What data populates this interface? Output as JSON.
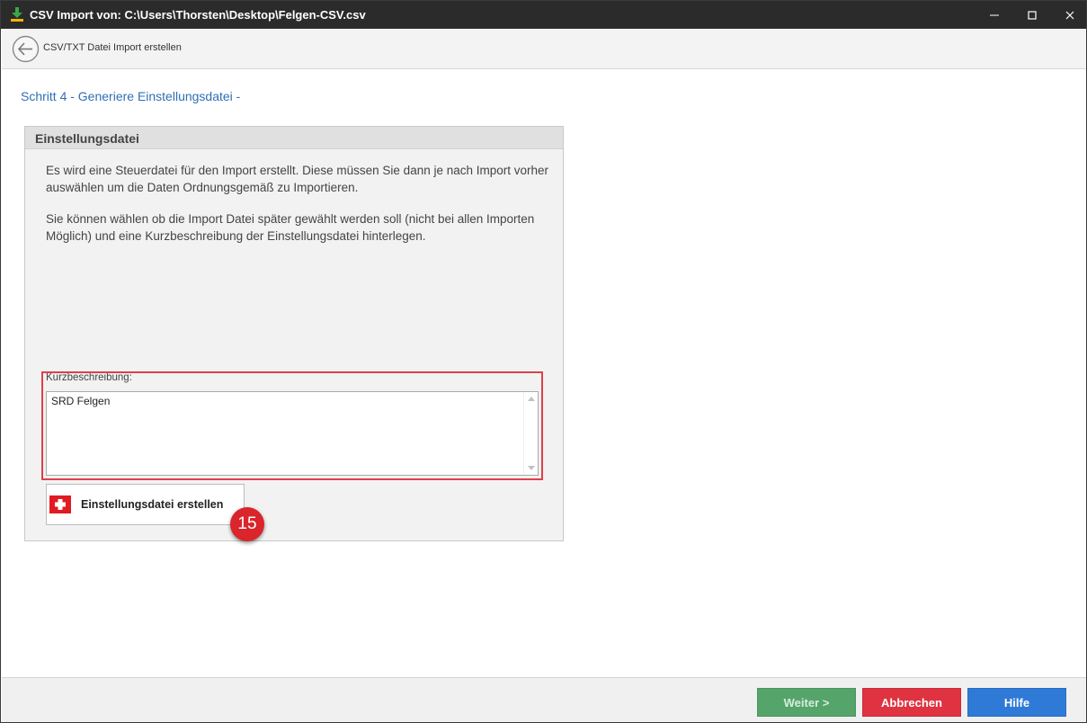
{
  "window": {
    "title": "CSV Import von: C:\\Users\\Thorsten\\Desktop\\Felgen-CSV.csv"
  },
  "navbar": {
    "title": "CSV/TXT Datei Import erstellen"
  },
  "step": {
    "title": "Schritt 4 - Generiere Einstellungsdatei -"
  },
  "panel": {
    "header": "Einstellungsdatei",
    "paragraph1": "Es wird eine Steuerdatei für den Import erstellt. Diese müssen Sie dann je nach Import vorher auswählen um die Daten Ordnungsgemäß zu Importieren.",
    "paragraph2": "Sie können wählen ob die Import Datei später gewählt werden soll (nicht bei allen Importen Möglich) und eine Kurzbeschreibung der Einstellungsdatei hinterlegen."
  },
  "description_field": {
    "label": "Kurzbeschreibung:",
    "value": "SRD Felgen"
  },
  "create_button": {
    "label": "Einstellungsdatei erstellen",
    "icon": "swiss-flag-icon"
  },
  "annotation": {
    "badge": "15",
    "color": "#d9252b"
  },
  "footer": {
    "next_label": "Weiter >",
    "cancel_label": "Abbrechen",
    "help_label": "Hilfe"
  },
  "colors": {
    "accent_blue": "#2f6fb5",
    "next_green": "#55a56b",
    "cancel_red": "#df3342",
    "help_blue": "#2f7ad6"
  }
}
